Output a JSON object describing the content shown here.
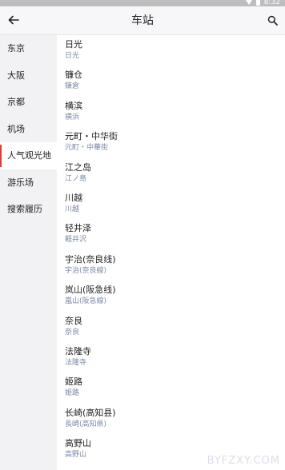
{
  "status_bar": {
    "time": "8:32"
  },
  "app_bar": {
    "title": "车站",
    "back_icon": "arrow-left-icon",
    "search_icon": "search-icon"
  },
  "sidebar": {
    "items": [
      {
        "label": "东京",
        "active": false
      },
      {
        "label": "大阪",
        "active": false
      },
      {
        "label": "京都",
        "active": false
      },
      {
        "label": "机场",
        "active": false
      },
      {
        "label": "人气观光地",
        "active": true
      },
      {
        "label": "游乐场",
        "active": false
      },
      {
        "label": "搜索履历",
        "active": false
      }
    ],
    "active_color": "#e53935"
  },
  "stations": [
    {
      "name": "日光",
      "sub": "日光"
    },
    {
      "name": "镰仓",
      "sub": "鎌倉"
    },
    {
      "name": "横滨",
      "sub": "横浜"
    },
    {
      "name": "元町・中华街",
      "sub": "元町・中華街"
    },
    {
      "name": "江之岛",
      "sub": "江ノ島"
    },
    {
      "name": "川越",
      "sub": "川越"
    },
    {
      "name": "轻井泽",
      "sub": "軽井沢"
    },
    {
      "name": "宇治(奈良线)",
      "sub": "宇治(奈良線)"
    },
    {
      "name": "岚山(阪急线)",
      "sub": "嵐山(阪急線)"
    },
    {
      "name": "奈良",
      "sub": "奈良"
    },
    {
      "name": "法隆寺",
      "sub": "法隆寺"
    },
    {
      "name": "姬路",
      "sub": "姫路"
    },
    {
      "name": "长崎(高知县)",
      "sub": "長崎(高知県)"
    },
    {
      "name": "高野山",
      "sub": "高野山"
    }
  ],
  "watermark": "BYFZXY.COM"
}
